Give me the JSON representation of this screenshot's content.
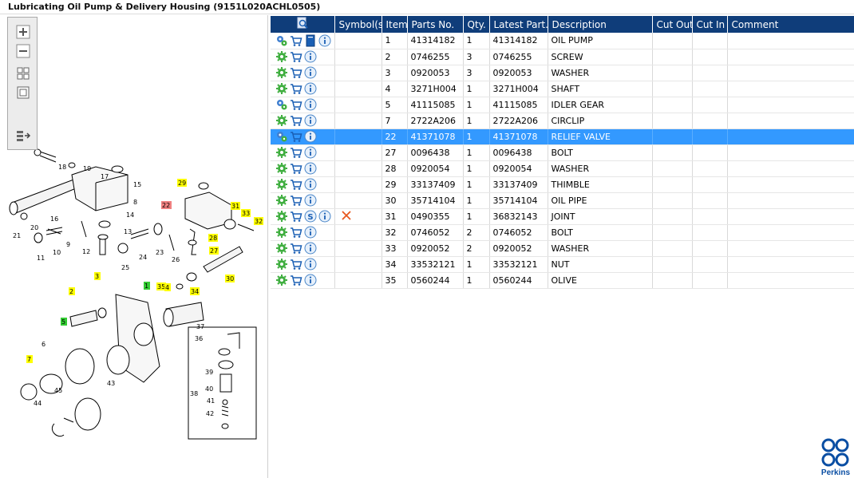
{
  "title": "Lubricating Oil Pump & Delivery Housing (9151L020ACHL0505)",
  "toolbar": {
    "tools": [
      "zoom-in-icon",
      "zoom-out-icon",
      "fit-all-icon",
      "fit-page-icon",
      "split-view-icon"
    ]
  },
  "diagram": {
    "callouts": [
      {
        "label": "18",
        "highlight": "none"
      },
      {
        "label": "19",
        "highlight": "none"
      },
      {
        "label": "17",
        "highlight": "none"
      },
      {
        "label": "15",
        "highlight": "none"
      },
      {
        "label": "29",
        "highlight": "yellow"
      },
      {
        "label": "22",
        "highlight": "red"
      },
      {
        "label": "31",
        "highlight": "yellow"
      },
      {
        "label": "33",
        "highlight": "yellow"
      },
      {
        "label": "32",
        "highlight": "yellow"
      },
      {
        "label": "8",
        "highlight": "none"
      },
      {
        "label": "14",
        "highlight": "none"
      },
      {
        "label": "16",
        "highlight": "none"
      },
      {
        "label": "20",
        "highlight": "none"
      },
      {
        "label": "21",
        "highlight": "none"
      },
      {
        "label": "13",
        "highlight": "none"
      },
      {
        "label": "10",
        "highlight": "none"
      },
      {
        "label": "9",
        "highlight": "none"
      },
      {
        "label": "11",
        "highlight": "none"
      },
      {
        "label": "12",
        "highlight": "none"
      },
      {
        "label": "23",
        "highlight": "none"
      },
      {
        "label": "24",
        "highlight": "none"
      },
      {
        "label": "25",
        "highlight": "none"
      },
      {
        "label": "26",
        "highlight": "none"
      },
      {
        "label": "28",
        "highlight": "yellow"
      },
      {
        "label": "27",
        "highlight": "yellow"
      },
      {
        "label": "30",
        "highlight": "yellow"
      },
      {
        "label": "35",
        "highlight": "yellow"
      },
      {
        "label": "34",
        "highlight": "yellow"
      },
      {
        "label": "3",
        "highlight": "yellow"
      },
      {
        "label": "1",
        "highlight": "green"
      },
      {
        "label": "4",
        "highlight": "yellow"
      },
      {
        "label": "2",
        "highlight": "yellow"
      },
      {
        "label": "5",
        "highlight": "green"
      },
      {
        "label": "6",
        "highlight": "none"
      },
      {
        "label": "7",
        "highlight": "yellow"
      },
      {
        "label": "37",
        "highlight": "none"
      },
      {
        "label": "36",
        "highlight": "none"
      },
      {
        "label": "39",
        "highlight": "none"
      },
      {
        "label": "40",
        "highlight": "none"
      },
      {
        "label": "38",
        "highlight": "none"
      },
      {
        "label": "41",
        "highlight": "none"
      },
      {
        "label": "42",
        "highlight": "none"
      },
      {
        "label": "43",
        "highlight": "none"
      },
      {
        "label": "45",
        "highlight": "none"
      },
      {
        "label": "44",
        "highlight": "none"
      }
    ]
  },
  "table": {
    "columns": [
      "",
      "Symbol(s)",
      "Item",
      "Parts No.",
      "Qty.",
      "Latest Part...",
      "Description",
      "Cut Out",
      "Cut In",
      "Comment"
    ],
    "header_icon": "search-doc-icon",
    "rows": [
      {
        "icons": [
          "gears-icon",
          "cart-icon",
          "document-icon",
          "info-icon"
        ],
        "symbol": "",
        "item": "1",
        "part_no": "41314182",
        "qty": "1",
        "latest": "41314182",
        "desc": "OIL PUMP",
        "cut_out": "",
        "cut_in": "",
        "comment": "",
        "selected": false
      },
      {
        "icons": [
          "gear-icon",
          "cart-icon",
          "info-icon"
        ],
        "symbol": "",
        "item": "2",
        "part_no": "0746255",
        "qty": "3",
        "latest": "0746255",
        "desc": "SCREW",
        "cut_out": "",
        "cut_in": "",
        "comment": "",
        "selected": false
      },
      {
        "icons": [
          "gear-icon",
          "cart-icon",
          "info-icon"
        ],
        "symbol": "",
        "item": "3",
        "part_no": "0920053",
        "qty": "3",
        "latest": "0920053",
        "desc": "WASHER",
        "cut_out": "",
        "cut_in": "",
        "comment": "",
        "selected": false
      },
      {
        "icons": [
          "gear-icon",
          "cart-icon",
          "info-icon"
        ],
        "symbol": "",
        "item": "4",
        "part_no": "3271H004",
        "qty": "1",
        "latest": "3271H004",
        "desc": "SHAFT",
        "cut_out": "",
        "cut_in": "",
        "comment": "",
        "selected": false
      },
      {
        "icons": [
          "gears-icon",
          "cart-icon",
          "info-icon"
        ],
        "symbol": "",
        "item": "5",
        "part_no": "41115085",
        "qty": "1",
        "latest": "41115085",
        "desc": "IDLER GEAR",
        "cut_out": "",
        "cut_in": "",
        "comment": "",
        "selected": false
      },
      {
        "icons": [
          "gear-icon",
          "cart-icon",
          "info-icon"
        ],
        "symbol": "",
        "item": "7",
        "part_no": "2722A206",
        "qty": "1",
        "latest": "2722A206",
        "desc": "CIRCLIP",
        "cut_out": "",
        "cut_in": "",
        "comment": "",
        "selected": false
      },
      {
        "icons": [
          "gears-icon",
          "cart-icon",
          "info-icon"
        ],
        "symbol": "",
        "item": "22",
        "part_no": "41371078",
        "qty": "1",
        "latest": "41371078",
        "desc": "RELIEF VALVE",
        "cut_out": "",
        "cut_in": "",
        "comment": "",
        "selected": true
      },
      {
        "icons": [
          "gear-icon",
          "cart-icon",
          "info-icon"
        ],
        "symbol": "",
        "item": "27",
        "part_no": "0096438",
        "qty": "1",
        "latest": "0096438",
        "desc": "BOLT",
        "cut_out": "",
        "cut_in": "",
        "comment": "",
        "selected": false
      },
      {
        "icons": [
          "gear-icon",
          "cart-icon",
          "info-icon"
        ],
        "symbol": "",
        "item": "28",
        "part_no": "0920054",
        "qty": "1",
        "latest": "0920054",
        "desc": "WASHER",
        "cut_out": "",
        "cut_in": "",
        "comment": "",
        "selected": false
      },
      {
        "icons": [
          "gear-icon",
          "cart-icon",
          "info-icon"
        ],
        "symbol": "",
        "item": "29",
        "part_no": "33137409",
        "qty": "1",
        "latest": "33137409",
        "desc": "THIMBLE",
        "cut_out": "",
        "cut_in": "",
        "comment": "",
        "selected": false
      },
      {
        "icons": [
          "gear-icon",
          "cart-icon",
          "info-icon"
        ],
        "symbol": "",
        "item": "30",
        "part_no": "35714104",
        "qty": "1",
        "latest": "35714104",
        "desc": "OIL PIPE",
        "cut_out": "",
        "cut_in": "",
        "comment": "",
        "selected": false
      },
      {
        "icons": [
          "gear-icon",
          "cart-icon",
          "superseded-icon",
          "info-icon"
        ],
        "symbol": "cross-icon",
        "item": "31",
        "part_no": "0490355",
        "qty": "1",
        "latest": "36832143",
        "desc": "JOINT",
        "cut_out": "",
        "cut_in": "",
        "comment": "",
        "selected": false
      },
      {
        "icons": [
          "gear-icon",
          "cart-icon",
          "info-icon"
        ],
        "symbol": "",
        "item": "32",
        "part_no": "0746052",
        "qty": "2",
        "latest": "0746052",
        "desc": "BOLT",
        "cut_out": "",
        "cut_in": "",
        "comment": "",
        "selected": false
      },
      {
        "icons": [
          "gear-icon",
          "cart-icon",
          "info-icon"
        ],
        "symbol": "",
        "item": "33",
        "part_no": "0920052",
        "qty": "2",
        "latest": "0920052",
        "desc": "WASHER",
        "cut_out": "",
        "cut_in": "",
        "comment": "",
        "selected": false
      },
      {
        "icons": [
          "gear-icon",
          "cart-icon",
          "info-icon"
        ],
        "symbol": "",
        "item": "34",
        "part_no": "33532121",
        "qty": "1",
        "latest": "33532121",
        "desc": "NUT",
        "cut_out": "",
        "cut_in": "",
        "comment": "",
        "selected": false
      },
      {
        "icons": [
          "gear-icon",
          "cart-icon",
          "info-icon"
        ],
        "symbol": "",
        "item": "35",
        "part_no": "0560244",
        "qty": "1",
        "latest": "0560244",
        "desc": "OLIVE",
        "cut_out": "",
        "cut_in": "",
        "comment": "",
        "selected": false
      }
    ]
  },
  "brand": {
    "name": "Perkins",
    "color": "#0a4ea3"
  },
  "colors": {
    "header_bg": "#0f3d7a",
    "selected_row": "#3399ff",
    "callout_yellow": "#ffff00",
    "callout_green": "#33cc33",
    "callout_red": "#f08080"
  }
}
